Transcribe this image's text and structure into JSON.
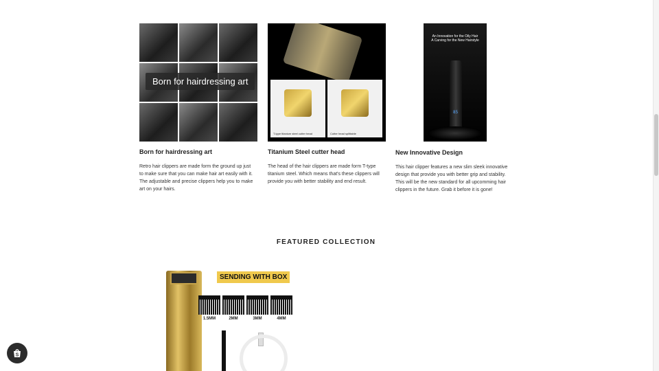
{
  "features": [
    {
      "overlay_label": "Born for hairdressing art",
      "title": "Born for hairdressing art",
      "text": "Retro hair clippers are made form the ground up just to make sure that you can make hair art easily with it. The adjustable and precise clippers help you to make art on your hairs."
    },
    {
      "title": "Titanium Steel cutter head",
      "text": "The head of the hair clippers are made form T-type titanium steel. Which means that's these clippers will provide you with better stability and end result.",
      "image_captions": [
        "T-type titanium steel cutter head",
        "Cutter head splittable"
      ]
    },
    {
      "title": "New Innovative Design",
      "text": "This hair clipper features a new slim sleek innovative design that provide you with better grip and stability. This will be the new standard for all upcomming hair clippers in the future. Grab it before it is gone!",
      "poster_line1": "An Innovation for the Oily Hair",
      "poster_line2": "A Carving for the New Hairstyle",
      "led_value": "85"
    }
  ],
  "featured": {
    "title": "FEATURED COLLECTION",
    "badge": "SENDING WITH BOX",
    "comb_sizes": [
      "1.5MM",
      "2MM",
      "3MM",
      "4MM"
    ]
  },
  "icons": {
    "shop": "shopify-bag-icon"
  },
  "colors": {
    "badge_bg": "#f0c94d",
    "shop_btn_bg": "#2c2c2c"
  }
}
